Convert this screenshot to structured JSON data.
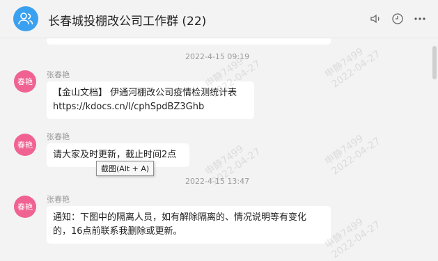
{
  "header": {
    "title": "长春城投棚改公司工作群 (22)"
  },
  "watermarks": [
    {
      "name": "申静7499",
      "date": "2022-04-27"
    },
    {
      "name": "申静7499",
      "date": "2022-04-27"
    },
    {
      "name": "申静7499",
      "date": "2022-04-27"
    },
    {
      "name": "申静7499",
      "date": "2022-04-27"
    },
    {
      "name": "申静7499",
      "date": "2022-04-27"
    }
  ],
  "messages": {
    "ts1": "2022-4-15 09:19",
    "msg1": {
      "sender": "张春艳",
      "avatar_text": "春艳",
      "line1": "【金山文档】 伊通河棚改公司疫情检测统计表",
      "line2": "https://kdocs.cn/l/cphSpdBZ3Ghb"
    },
    "msg2": {
      "sender": "张春艳",
      "avatar_text": "春艳",
      "text": "请大家及时更新，截止时间2点"
    },
    "ts2": "2022-4-15 13:47",
    "msg3": {
      "sender": "张春艳",
      "avatar_text": "春艳",
      "line1": "通知：下图中的隔离人员，如有解除隔离的、情况说明等有变化",
      "line2": "的，16点前联系我删除或更新。"
    }
  },
  "tooltip": "截图(Alt + A)",
  "colors": {
    "avatar": "#f06292",
    "group_avatar": "#3aa0f0",
    "background": "#f3f3f3"
  }
}
